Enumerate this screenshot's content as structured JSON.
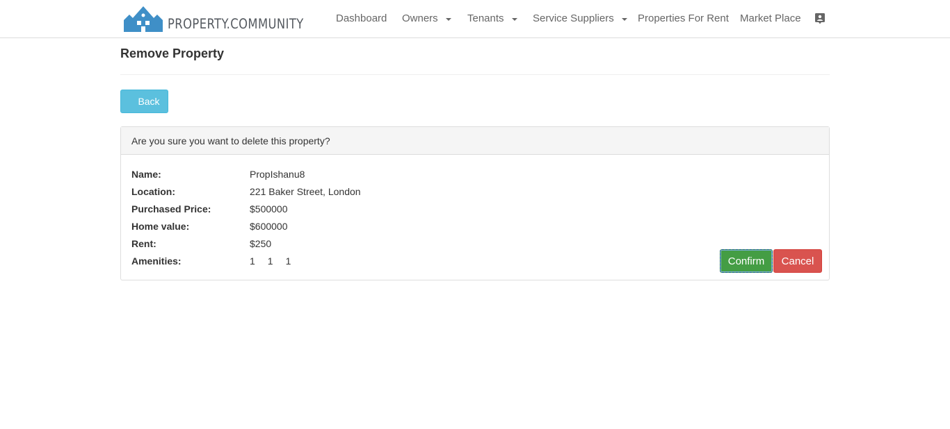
{
  "brand": {
    "name": "PROPERTY.COMMUNITY",
    "logo_color": "#3f8fc7"
  },
  "nav": {
    "dashboard": "Dashboard",
    "owners": "Owners",
    "tenants": "Tenants",
    "service_suppliers": "Service Suppliers",
    "properties_for_rent": "Properties For Rent",
    "market_place": "Market Place",
    "account_icon": "contact-card-icon"
  },
  "page": {
    "title": "Remove Property",
    "back_label": "Back"
  },
  "panel": {
    "heading": "Are you sure you want to delete this property?",
    "fields": {
      "name_label": "Name:",
      "name_value": "PropIshanu8",
      "location_label": "Location:",
      "location_value": "221 Baker Street, London",
      "purchased_price_label": "Purchased Price:",
      "purchased_price_value": "$500000",
      "home_value_label": "Home value:",
      "home_value_value": "$600000",
      "rent_label": "Rent:",
      "rent_value": "$250",
      "amenities_label": "Amenities:",
      "amenities": [
        "1",
        "1",
        "1"
      ]
    },
    "confirm_label": "Confirm",
    "cancel_label": "Cancel"
  },
  "colors": {
    "info": "#5bc0de",
    "success": "#449d44",
    "danger": "#d9534f"
  }
}
